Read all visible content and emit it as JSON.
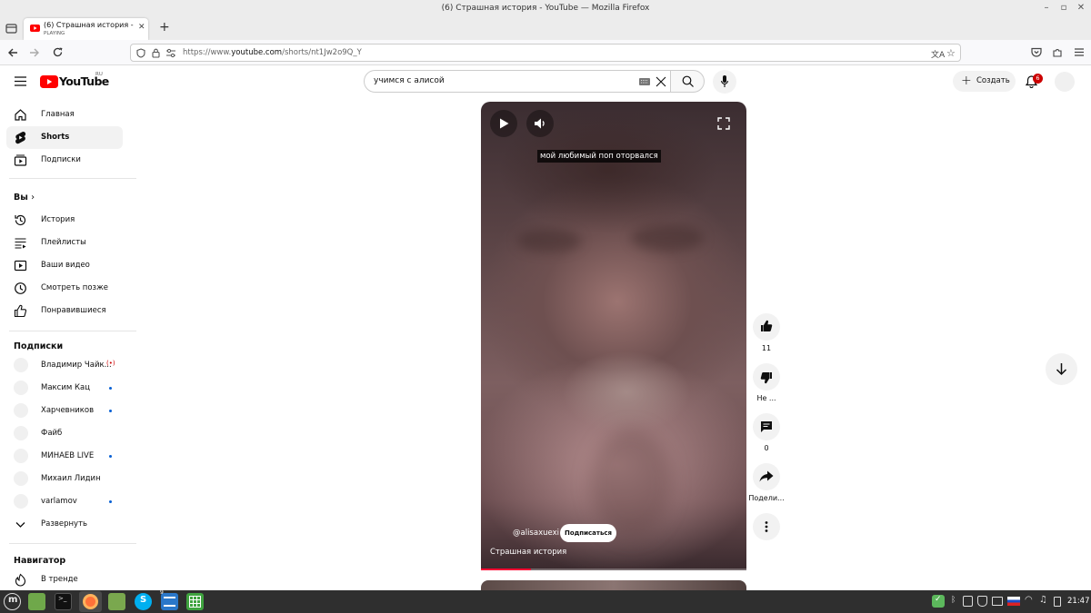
{
  "window": {
    "title": "(6) Страшная история - YouTube — Mozilla Firefox"
  },
  "browser": {
    "tab_title": "(6) Страшная история - YouTube",
    "tab_status": "PLAYING",
    "url_prefix": "https://www.",
    "url_domain": "youtube.com",
    "url_path": "/shorts/nt1Jw2o9Q_Y"
  },
  "youtube": {
    "logo_text": "YouTube",
    "region": "RU",
    "search_value": "учимся с алисой",
    "create_label": "Создать",
    "notification_count": "6"
  },
  "sidebar": {
    "main": [
      {
        "label": "Главная",
        "icon": "home-icon"
      },
      {
        "label": "Shorts",
        "icon": "shorts-icon",
        "active": true
      },
      {
        "label": "Подписки",
        "icon": "subscriptions-icon"
      }
    ],
    "you_heading": "Вы",
    "you": [
      {
        "label": "История",
        "icon": "history-icon"
      },
      {
        "label": "Плейлисты",
        "icon": "playlists-icon"
      },
      {
        "label": "Ваши видео",
        "icon": "your-videos-icon"
      },
      {
        "label": "Смотреть позже",
        "icon": "watch-later-icon"
      },
      {
        "label": "Понравившиеся",
        "icon": "liked-icon"
      }
    ],
    "subs_heading": "Подписки",
    "subscriptions": [
      {
        "label": "Владимир Чайк...",
        "badge": "live"
      },
      {
        "label": "Максим Кац",
        "badge": "dot"
      },
      {
        "label": "Харчевников",
        "badge": "dot"
      },
      {
        "label": "Файб",
        "badge": "none"
      },
      {
        "label": "МИНАЕВ LIVE",
        "badge": "dot"
      },
      {
        "label": "Михаил Лидин",
        "badge": "none"
      },
      {
        "label": "varlamov",
        "badge": "dot"
      }
    ],
    "expand_label": "Развернуть",
    "navigator_heading": "Навигатор",
    "navigator": [
      {
        "label": "В тренде",
        "icon": "trending-icon"
      }
    ]
  },
  "short": {
    "caption": "мой любимый поп оторвался",
    "channel": "@alisaxuexi",
    "subscribe_label": "Подписаться",
    "title": "Страшная история",
    "progress": 0.19
  },
  "actions": {
    "likes": "11",
    "dislike_label": "Не ...",
    "comments": "0",
    "share_label": "Подели..."
  },
  "taskbar": {
    "clock": "21:47",
    "badge_count": "9"
  },
  "colors": {
    "youtube_red": "#ff0000",
    "accent_blue": "#065fd4",
    "live_red": "#cc0000",
    "taskbar_bg": "#2f2f2f"
  }
}
